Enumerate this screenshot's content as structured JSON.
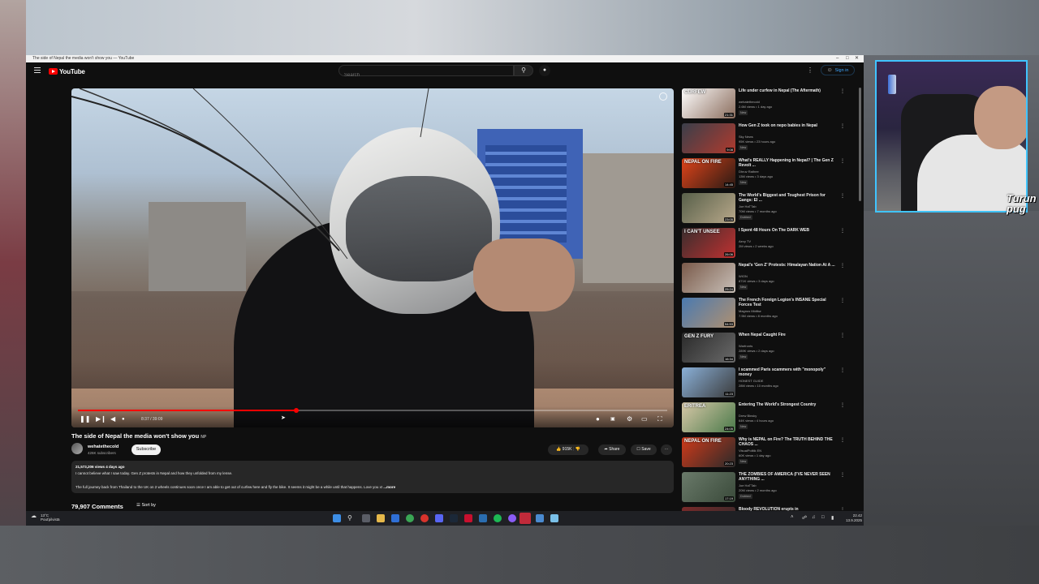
{
  "window": {
    "tab_title": "The side of Nepal the media won't show you — YouTube",
    "controls": [
      "–",
      "□",
      "✕"
    ]
  },
  "header": {
    "logo_text": "YouTube",
    "search_placeholder": "Search",
    "signin_label": "Sign in"
  },
  "player": {
    "time_display": "8:37 / 39:09",
    "progress_fraction": 0.37,
    "buffered_fraction": 0.42
  },
  "video": {
    "title": "The side of Nepal the media won't show you",
    "title_suffix": "NP",
    "channel": "wehatethecold",
    "subscribers": "426K subscribers",
    "subscribe_label": "Subscribe",
    "likes": "915K",
    "share_label": "Share",
    "save_label": "Save",
    "description_meta": "21,573,206 views  4 days ago",
    "description_line1": "I cannot believe what I saw today. Gen Z protests in Nepal and how they unfolded from my lense.",
    "description_line2": "The full journey back from Thailand to the UK on 2 wheels continues soon once I am able to get out of curfew here and fly the bike. It seems it might be a while until that happens. Love you x!",
    "more_label": "...more",
    "comments_count": "79,907 Comments",
    "sort_label": "Sort by"
  },
  "sidebar": {
    "items": [
      {
        "title": "Life under curfew in Nepal (The Aftermath)",
        "channel": "wehatethecold",
        "views": "2.6M views • 1 day ago",
        "badge": "New",
        "duration": "21:31",
        "thumb_text": "CURFEW",
        "c1": "#ffffff",
        "c2": "#8a6c5c"
      },
      {
        "title": "How Gen Z took on nepo babies in Nepal",
        "channel": "Sky News",
        "views": "95K views • 23 hours ago",
        "badge": "New",
        "duration": "9:08",
        "thumb_text": "",
        "c1": "#3a3f4a",
        "c2": "#b03a2e"
      },
      {
        "title": "What's REALLY Happening in Nepal? | The Gen Z Revolt ...",
        "channel": "Dhruv Rathee",
        "views": "13M views • 3 days ago",
        "badge": "New",
        "duration": "14:45",
        "thumb_text": "NEPAL ON FIRE",
        "c1": "#e0441a",
        "c2": "#2a1a14"
      },
      {
        "title": "The World's Biggest and Toughest Prison for Gangs: El ...",
        "channel": "Joe HaTTab",
        "views": "70M views • 7 months ago",
        "badge": "Dubbed",
        "duration": "23:05",
        "thumb_text": "",
        "c1": "#58604a",
        "c2": "#b8a88a"
      },
      {
        "title": "I Spent 48 Hours On The DARK WEB",
        "channel": "Aevy TV",
        "views": "2M views • 2 weeks ago",
        "badge": "",
        "duration": "26:06",
        "thumb_text": "I CAN'T UNSEE",
        "c1": "#3a2e2e",
        "c2": "#c03030"
      },
      {
        "title": "Nepal's 'Gen Z' Protests: Himalayan Nation At A ...",
        "channel": "WION",
        "views": "871K views • 3 days ago",
        "badge": "New",
        "duration": "25:24",
        "thumb_text": "",
        "c1": "#7a5a4a",
        "c2": "#c8c0b8"
      },
      {
        "title": "The French Foreign Legion's INSANE Special Forces Test",
        "channel": "Magnus Midtbø",
        "views": "7.5M views • 8 months ago",
        "badge": "",
        "duration": "54:53",
        "thumb_text": "",
        "c1": "#4a7ab0",
        "c2": "#b09070"
      },
      {
        "title": "When Nepal Caught Fire",
        "channel": "Warfronts",
        "views": "289K views • 2 days ago",
        "badge": "New",
        "duration": "16:34",
        "thumb_text": "GEN Z FURY",
        "c1": "#2a2a2a",
        "c2": "#6a6a6a"
      },
      {
        "title": "I scammed Paris scammers with \"monopoly\" money",
        "channel": "HONEST GUIDE",
        "views": "28M views • 10 months ago",
        "badge": "",
        "duration": "11:23",
        "thumb_text": "",
        "c1": "#8ab0d8",
        "c2": "#3a3a3a"
      },
      {
        "title": "Entering The World's Strongest Country",
        "channel": "Drew Binsky",
        "views": "64K views • 4 hours ago",
        "badge": "New",
        "duration": "24:05",
        "thumb_text": "ERITREA",
        "c1": "#d8c8a8",
        "c2": "#4a7a4a"
      },
      {
        "title": "Why is NEPAL on Fire? The TRUTH BEHIND THE CHAOS ...",
        "channel": "VisualPolitik EN",
        "views": "60K views • 1 day ago",
        "badge": "New",
        "duration": "20:23",
        "thumb_text": "NEPAL ON FIRE",
        "c1": "#d03a1a",
        "c2": "#2a2a2a"
      },
      {
        "title": "THE ZOMBIES OF AMERICA (I'VE NEVER SEEN ANYTHING ...",
        "channel": "Joe HaTTab",
        "views": "20M views • 2 months ago",
        "badge": "Dubbed",
        "duration": "17:19",
        "thumb_text": "",
        "c1": "#6a7a6a",
        "c2": "#3a4a3a"
      },
      {
        "title": "Bloody REVOLUTION erupts in",
        "channel": "",
        "views": "",
        "badge": "",
        "duration": "",
        "thumb_text": "",
        "c1": "#7a2a2a",
        "c2": "#2a2a2a"
      }
    ]
  },
  "taskbar": {
    "weather_temp": "13°C",
    "weather_desc": "Pouťpilvistä",
    "time": "22.42",
    "date": "13.9.2025"
  },
  "webcam": {
    "label": "Turun pug"
  },
  "colors": {
    "accent_red": "#ff0000",
    "webcam_border": "#40c4ff",
    "link_blue": "#3ea6ff"
  }
}
